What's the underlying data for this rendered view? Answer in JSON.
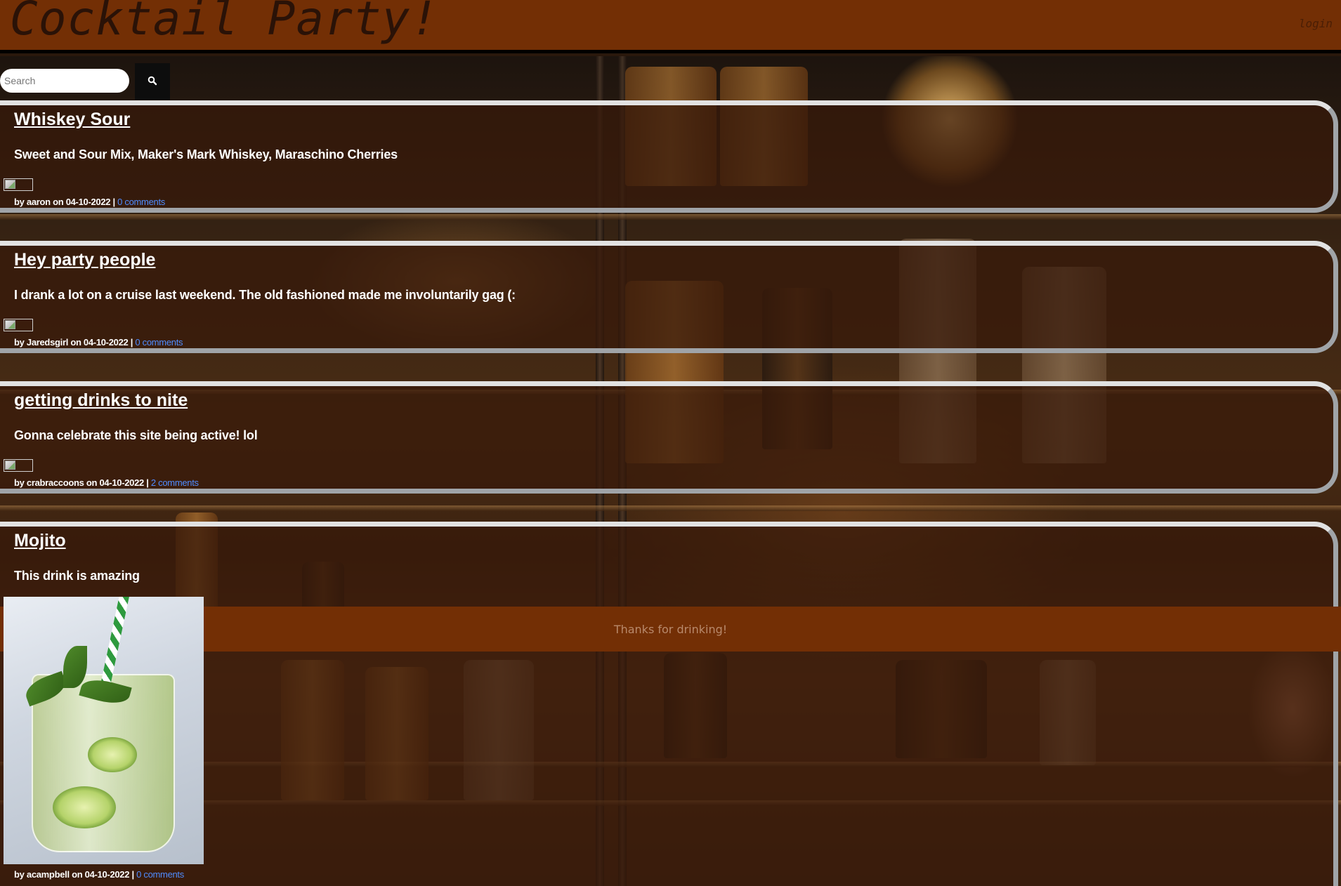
{
  "header": {
    "title": "Cocktail Party!",
    "login_label": "login"
  },
  "search": {
    "placeholder": "Search",
    "button_icon": "search-icon"
  },
  "posts": [
    {
      "title": "Whiskey Sour",
      "body": "Sweet and Sour Mix, Maker's Mark Whiskey, Maraschino Cherries",
      "meta": "by aaron on 04-10-2022 |",
      "comments": "0 comments",
      "image": "broken"
    },
    {
      "title": "Hey party people",
      "body": "I drank a lot on a cruise last weekend. The old fashioned made me involuntarily gag (:",
      "meta": "by Jaredsgirl on 04-10-2022 |",
      "comments": "0 comments",
      "image": "broken"
    },
    {
      "title": "getting drinks to nite",
      "body": "Gonna celebrate this site being active! lol",
      "meta": "by crabraccoons on 04-10-2022 |",
      "comments": "2 comments",
      "image": "broken"
    },
    {
      "title": "Mojito",
      "body": "This drink is amazing",
      "meta": "by acampbell on 04-10-2022 |",
      "comments": "0 comments",
      "image": "mojito-photo"
    }
  ],
  "footer": {
    "text": "Thanks for drinking!"
  },
  "colors": {
    "header_bg": "#732f05",
    "post_border": "#a0a4a8",
    "link": "#4f8cff",
    "text": "#ffffff"
  }
}
